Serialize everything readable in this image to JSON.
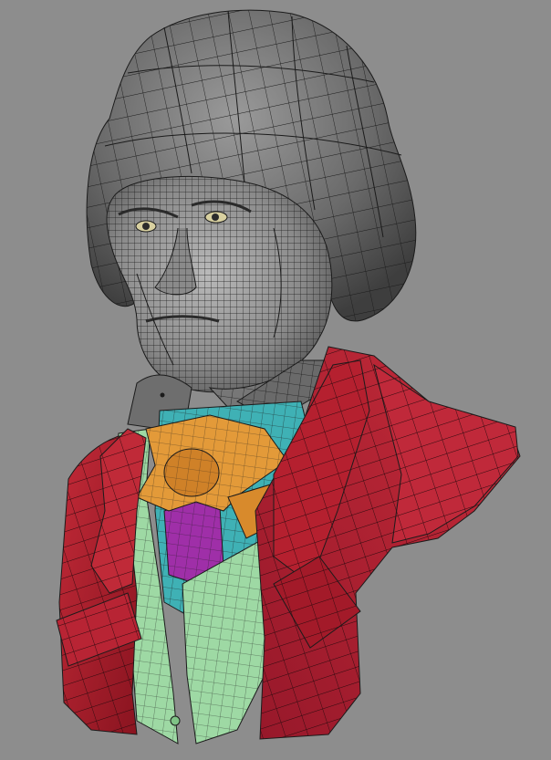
{
  "scene": {
    "background_color": "#8d8d8d",
    "subject": "wireframe-bust",
    "palette": {
      "skin": "#8e8e8e",
      "hair": "#6f6f6f",
      "wire": "#1b1b1b",
      "coat": "#b11f2e",
      "coat_shadow": "#8d1421",
      "collar": "#6e6e6e",
      "shirt": "#3fb1b5",
      "vest": "#9ed9a4",
      "cravat": "#e39a39",
      "cravat_shadow": "#c87a22",
      "tie": "#9f2fa8",
      "eye": "#d8d0a0"
    }
  }
}
